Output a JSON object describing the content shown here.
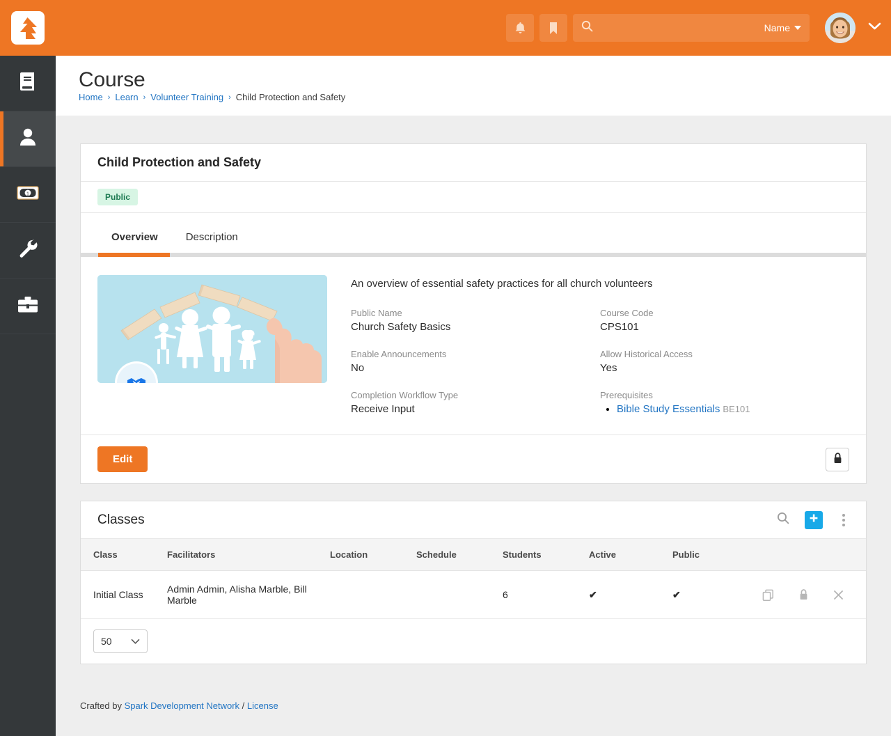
{
  "topbar": {
    "logo_name": "rock-rms-logo",
    "notifications_icon": "bell-icon",
    "bookmark_icon": "bookmark-icon",
    "search_icon": "search-icon",
    "search_placeholder": "",
    "search_value": "",
    "name_selector_label": "Name",
    "avatar_label": "user-avatar",
    "brand_color": "#ee7624"
  },
  "sidebar": {
    "items": [
      {
        "name": "sidebar-item-content",
        "icon": "book-icon",
        "active": false
      },
      {
        "name": "sidebar-item-people",
        "icon": "person-icon",
        "active": true
      },
      {
        "name": "sidebar-item-finance",
        "icon": "money-bill-icon",
        "active": false
      },
      {
        "name": "sidebar-item-admin-tools",
        "icon": "wrench-icon",
        "active": false
      },
      {
        "name": "sidebar-item-toolbox",
        "icon": "briefcase-icon",
        "active": false
      }
    ]
  },
  "page": {
    "title": "Course",
    "breadcrumb": [
      {
        "label": "Home",
        "link": true
      },
      {
        "label": "Learn",
        "link": true
      },
      {
        "label": "Volunteer Training",
        "link": true
      },
      {
        "label": "Child Protection and Safety",
        "link": false
      }
    ],
    "breadcrumb_separator": "›"
  },
  "course_panel": {
    "title": "Child Protection and Safety",
    "status_badge": "Public",
    "status_badge_bg": "#d7f5e4",
    "status_badge_color": "#1d7a52",
    "tabs": [
      {
        "label": "Overview",
        "active": true
      },
      {
        "label": "Description",
        "active": false
      }
    ],
    "image_alt": "child-safety-course-image",
    "image_badge_icon": "handshake-icon",
    "description": "An overview of essential safety practices for all church volunteers",
    "fields": [
      {
        "label": "Public Name",
        "value": "Church Safety Basics"
      },
      {
        "label": "Course Code",
        "value": "CPS101"
      },
      {
        "label": "Enable Announcements",
        "value": "No"
      },
      {
        "label": "Allow Historical Access",
        "value": "Yes"
      },
      {
        "label": "Completion Workflow Type",
        "value": "Receive Input"
      }
    ],
    "prerequisites_label": "Prerequisites",
    "prerequisites": [
      {
        "name": "Bible Study Essentials",
        "code": "BE101"
      }
    ],
    "edit_button": "Edit",
    "lock_icon": "lock-icon"
  },
  "classes_panel": {
    "title": "Classes",
    "search_icon": "search-icon",
    "add_icon": "plus-icon",
    "add_icon_bg": "#18a9e8",
    "menu_icon": "kebab-menu-icon",
    "columns": [
      "Class",
      "Facilitators",
      "Location",
      "Schedule",
      "Students",
      "Active",
      "Public"
    ],
    "rows": [
      {
        "class": "Initial Class",
        "facilitators": "Admin Admin, Alisha Marble, Bill Marble",
        "location": "",
        "schedule": "",
        "students": "6",
        "active": true,
        "public": true,
        "active_mark": "✔",
        "public_mark": "✔",
        "row_actions": [
          "copy-icon",
          "lock-icon",
          "delete-icon"
        ]
      }
    ],
    "page_size": "50"
  },
  "footer": {
    "prefix": "Crafted by ",
    "org_link": "Spark Development Network",
    "divider": " / ",
    "license_link": "License"
  }
}
